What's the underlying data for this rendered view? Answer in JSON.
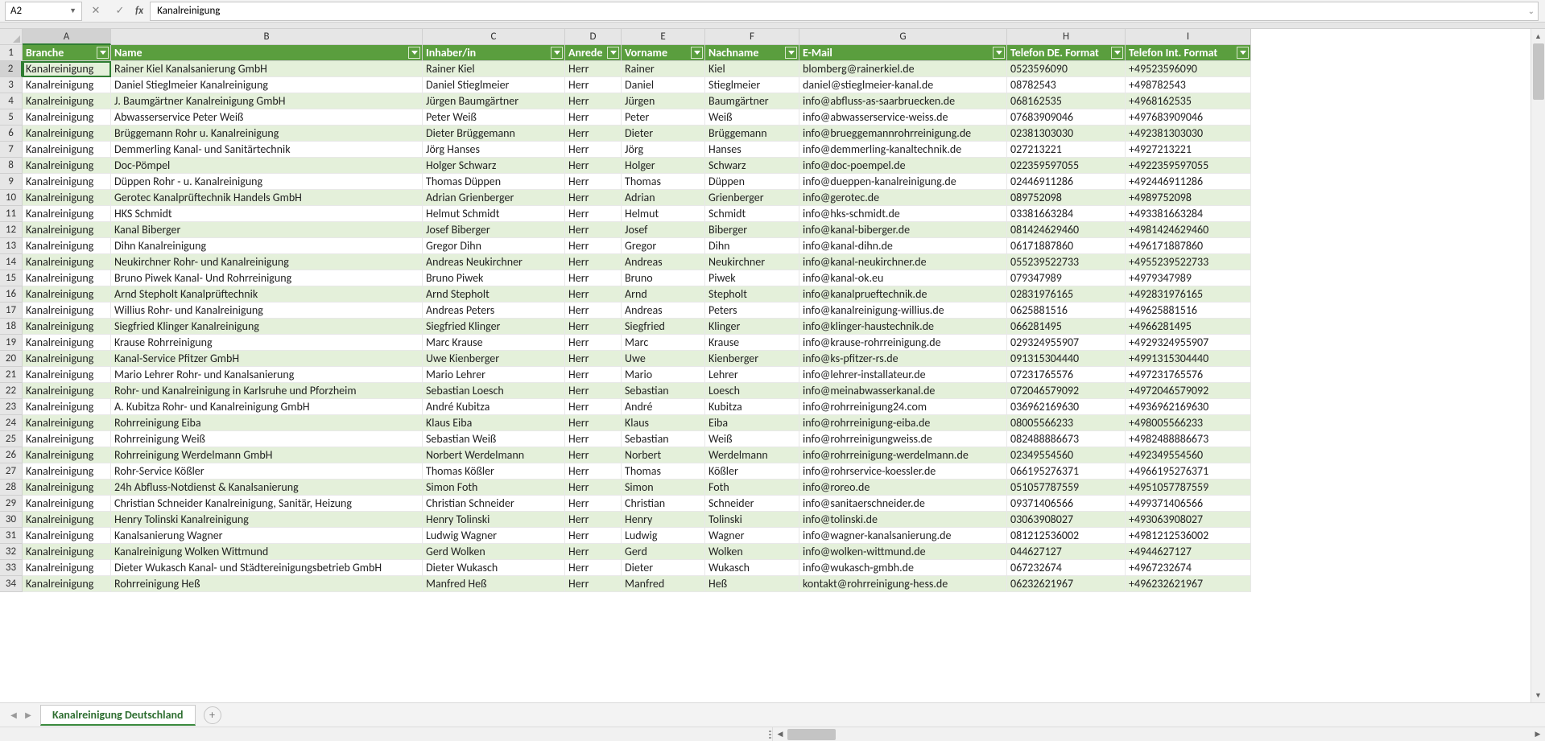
{
  "namebox": "A2",
  "formula": "Kanalreinigung",
  "sheet_tab": "Kanalreinigung Deutschland",
  "col_letters": [
    "A",
    "B",
    "C",
    "D",
    "E",
    "F",
    "G",
    "H",
    "I"
  ],
  "headers": [
    "Branche",
    "Name",
    "Inhaber/in",
    "Anrede",
    "Vorname",
    "Nachname",
    "E-Mail",
    "Telefon DE. Format",
    "Telefon Int. Format"
  ],
  "rows": [
    [
      "Kanalreinigung",
      "Rainer Kiel Kanalsanierung GmbH",
      "Rainer Kiel",
      "Herr",
      "Rainer",
      "Kiel",
      "blomberg@rainerkiel.de",
      "0523596090",
      "+49523596090"
    ],
    [
      "Kanalreinigung",
      "Daniel Stieglmeier Kanalreinigung",
      "Daniel Stieglmeier",
      "Herr",
      "Daniel",
      "Stieglmeier",
      "daniel@stieglmeier-kanal.de",
      "08782543",
      "+498782543"
    ],
    [
      "Kanalreinigung",
      "J. Baumgärtner Kanalreinigung GmbH",
      "Jürgen Baumgärtner",
      "Herr",
      "Jürgen",
      "Baumgärtner",
      "info@abfluss-as-saarbruecken.de",
      "068162535",
      "+4968162535"
    ],
    [
      "Kanalreinigung",
      "Abwasserservice Peter Weiß",
      "Peter Weiß",
      "Herr",
      "Peter",
      "Weiß",
      "info@abwasserservice-weiss.de",
      "07683909046",
      "+497683909046"
    ],
    [
      "Kanalreinigung",
      "Brüggemann Rohr u. Kanalreinigung",
      "Dieter Brüggemann",
      "Herr",
      "Dieter",
      "Brüggemann",
      "info@brueggemannrohrreinigung.de",
      "02381303030",
      "+492381303030"
    ],
    [
      "Kanalreinigung",
      "Demmerling Kanal- und Sanitärtechnik",
      "Jörg Hanses",
      "Herr",
      "Jörg",
      "Hanses",
      "info@demmerling-kanaltechnik.de",
      "027213221",
      "+4927213221"
    ],
    [
      "Kanalreinigung",
      "Doc-Pömpel",
      "Holger Schwarz",
      "Herr",
      "Holger",
      "Schwarz",
      "info@doc-poempel.de",
      "022359597055",
      "+4922359597055"
    ],
    [
      "Kanalreinigung",
      "Düppen Rohr - u. Kanalreinigung",
      "Thomas Düppen",
      "Herr",
      "Thomas",
      "Düppen",
      "info@dueppen-kanalreinigung.de",
      "02446911286",
      "+492446911286"
    ],
    [
      "Kanalreinigung",
      "Gerotec Kanalprüftechnik Handels GmbH",
      "Adrian Grienberger",
      "Herr",
      "Adrian",
      "Grienberger",
      "info@gerotec.de",
      "089752098",
      "+4989752098"
    ],
    [
      "Kanalreinigung",
      "HKS Schmidt",
      "Helmut Schmidt",
      "Herr",
      "Helmut",
      "Schmidt",
      "info@hks-schmidt.de",
      "03381663284",
      "+493381663284"
    ],
    [
      "Kanalreinigung",
      "Kanal Biberger",
      "Josef Biberger",
      "Herr",
      "Josef",
      "Biberger",
      "info@kanal-biberger.de",
      "081424629460",
      "+4981424629460"
    ],
    [
      "Kanalreinigung",
      "Dihn Kanalreinigung",
      "Gregor Dihn",
      "Herr",
      "Gregor",
      "Dihn",
      "info@kanal-dihn.de",
      "06171887860",
      "+496171887860"
    ],
    [
      "Kanalreinigung",
      "Neukirchner Rohr- und Kanalreinigung",
      "Andreas Neukirchner",
      "Herr",
      "Andreas",
      "Neukirchner",
      "info@kanal-neukirchner.de",
      "055239522733",
      "+4955239522733"
    ],
    [
      "Kanalreinigung",
      "Bruno Piwek Kanal- Und Rohrreinigung",
      "Bruno Piwek",
      "Herr",
      "Bruno",
      "Piwek",
      "info@kanal-ok.eu",
      "079347989",
      "+4979347989"
    ],
    [
      "Kanalreinigung",
      "Arnd Stepholt Kanalprüftechnik",
      "Arnd Stepholt",
      "Herr",
      "Arnd",
      "Stepholt",
      "info@kanalprueftechnik.de",
      "02831976165",
      "+492831976165"
    ],
    [
      "Kanalreinigung",
      "Willius Rohr- und Kanalreinigung",
      "Andreas Peters",
      "Herr",
      "Andreas",
      "Peters",
      "info@kanalreinigung-willius.de",
      "0625881516",
      "+49625881516"
    ],
    [
      "Kanalreinigung",
      "Siegfried Klinger Kanalreinigung",
      "Siegfried Klinger",
      "Herr",
      "Siegfried",
      "Klinger",
      "info@klinger-haustechnik.de",
      "066281495",
      "+4966281495"
    ],
    [
      "Kanalreinigung",
      "Krause Rohrreinigung",
      "Marc Krause",
      "Herr",
      "Marc",
      "Krause",
      "info@krause-rohrreinigung.de",
      "029324955907",
      "+4929324955907"
    ],
    [
      "Kanalreinigung",
      "Kanal-Service Pfitzer GmbH",
      "Uwe Kienberger",
      "Herr",
      "Uwe",
      "Kienberger",
      "info@ks-pfitzer-rs.de",
      "091315304440",
      "+4991315304440"
    ],
    [
      "Kanalreinigung",
      "Mario Lehrer Rohr- und Kanalsanierung",
      "Mario Lehrer",
      "Herr",
      "Mario",
      "Lehrer",
      "info@lehrer-installateur.de",
      "07231765576",
      "+497231765576"
    ],
    [
      "Kanalreinigung",
      "Rohr- und Kanalreinigung in Karlsruhe und Pforzheim",
      "Sebastian Loesch",
      "Herr",
      "Sebastian",
      "Loesch",
      "info@meinabwasserkanal.de",
      "072046579092",
      "+4972046579092"
    ],
    [
      "Kanalreinigung",
      "A. Kubitza Rohr- und Kanalreinigung GmbH",
      "André Kubitza",
      "Herr",
      "André",
      "Kubitza",
      "info@rohrreinigung24.com",
      "036962169630",
      "+4936962169630"
    ],
    [
      "Kanalreinigung",
      "Rohrreinigung Eiba",
      "Klaus Eiba",
      "Herr",
      "Klaus",
      "Eiba",
      "info@rohrreinigung-eiba.de",
      "08005566233",
      "+498005566233"
    ],
    [
      "Kanalreinigung",
      "Rohrreinigung Weiß",
      "Sebastian Weiß",
      "Herr",
      "Sebastian",
      "Weiß",
      "info@rohrreinigungweiss.de",
      "082488886673",
      "+4982488886673"
    ],
    [
      "Kanalreinigung",
      "Rohrreinigung Werdelmann GmbH",
      "Norbert Werdelmann",
      "Herr",
      "Norbert",
      "Werdelmann",
      "info@rohrreinigung-werdelmann.de",
      "02349554560",
      "+492349554560"
    ],
    [
      "Kanalreinigung",
      "Rohr-Service Kößler",
      "Thomas Kößler",
      "Herr",
      "Thomas",
      "Kößler",
      "info@rohrservice-koessler.de",
      "066195276371",
      "+4966195276371"
    ],
    [
      "Kanalreinigung",
      "24h Abfluss-Notdienst & Kanalsanierung",
      "Simon Foth",
      "Herr",
      "Simon",
      "Foth",
      "info@roreo.de",
      "051057787559",
      "+4951057787559"
    ],
    [
      "Kanalreinigung",
      "Christian Schneider Kanalreinigung, Sanitär, Heizung",
      "Christian Schneider",
      "Herr",
      "Christian",
      "Schneider",
      "info@sanitaerschneider.de",
      "09371406566",
      "+499371406566"
    ],
    [
      "Kanalreinigung",
      "Henry Tolinski Kanalreinigung",
      "Henry Tolinski",
      "Herr",
      "Henry",
      "Tolinski",
      "info@tolinski.de",
      "03063908027",
      "+493063908027"
    ],
    [
      "Kanalreinigung",
      "Kanalsanierung Wagner",
      "Ludwig Wagner",
      "Herr",
      "Ludwig",
      "Wagner",
      "info@wagner-kanalsanierung.de",
      "081212536002",
      "+4981212536002"
    ],
    [
      "Kanalreinigung",
      "Kanalreinigung Wolken Wittmund",
      "Gerd Wolken",
      "Herr",
      "Gerd",
      "Wolken",
      "info@wolken-wittmund.de",
      "044627127",
      "+4944627127"
    ],
    [
      "Kanalreinigung",
      "Dieter Wukasch Kanal- und Städtereinigungsbetrieb GmbH",
      "Dieter Wukasch",
      "Herr",
      "Dieter",
      "Wukasch",
      "info@wukasch-gmbh.de",
      "067232674",
      "+4967232674"
    ],
    [
      "Kanalreinigung",
      "Rohrreinigung Heß",
      "Manfred Heß",
      "Herr",
      "Manfred",
      "Heß",
      "kontakt@rohrreinigung-hess.de",
      "06232621967",
      "+496232621967"
    ]
  ]
}
